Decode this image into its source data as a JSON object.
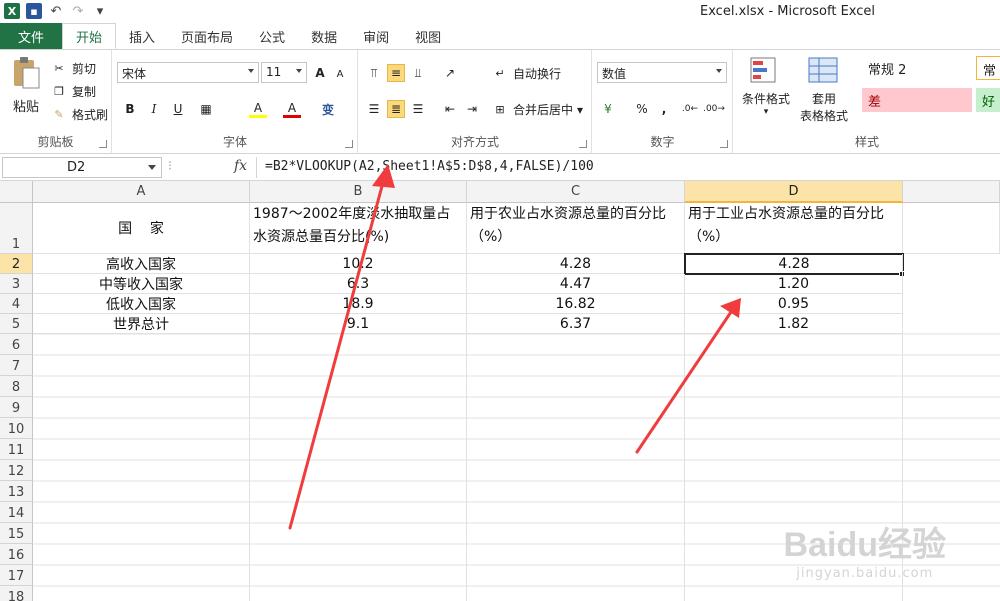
{
  "window": {
    "title": "Excel.xlsx - Microsoft Excel"
  },
  "qat": {
    "excel_icon": "X"
  },
  "tabs": [
    "文件",
    "开始",
    "插入",
    "页面布局",
    "公式",
    "数据",
    "审阅",
    "视图"
  ],
  "ribbon": {
    "clipboard": {
      "label": "剪贴板",
      "paste": "粘贴",
      "cut": "剪切",
      "copy": "复制",
      "format_painter": "格式刷"
    },
    "font": {
      "label": "字体",
      "font_name": "宋体",
      "font_size": "11",
      "grow": "A",
      "shrink": "A",
      "bold": "B",
      "italic": "I",
      "underline": "U",
      "highlight": "A",
      "font_color": "A",
      "wen": "变"
    },
    "alignment": {
      "label": "对齐方式",
      "wrap_text": "自动换行",
      "merge_center": "合并后居中"
    },
    "number": {
      "label": "数字",
      "format": "数值",
      "percent": "%",
      "comma": ","
    },
    "styles": {
      "label": "样式",
      "conditional": "条件格式",
      "table_format_1": "套用",
      "table_format_2": "表格格式",
      "cell_style_1": "常规 2",
      "cell_style_2": "差",
      "cell_style_3": "常",
      "cell_style_4": "好"
    }
  },
  "formula_bar": {
    "name_box": "D2",
    "fx": "fx",
    "formula": "=B2*VLOOKUP(A2,Sheet1!A$5:D$8,4,FALSE)/100"
  },
  "sheet": {
    "columns": [
      "A",
      "B",
      "C",
      "D"
    ],
    "rows": [
      "1",
      "2",
      "3",
      "4",
      "5",
      "6",
      "7",
      "8",
      "9",
      "10",
      "11",
      "12",
      "13",
      "14",
      "15",
      "16",
      "17",
      "18"
    ],
    "header_row": [
      "国    家",
      "1987～2002年度淡水抽取量占水资源总量百分比(%)",
      "用于农业占水资源总量的百分比（%）",
      "用于工业占水资源总量的百分比（%）"
    ],
    "data_rows": [
      [
        "高收入国家",
        "10.2",
        "4.28",
        "4.28"
      ],
      [
        "中等收入国家",
        "6.3",
        "4.47",
        "1.20"
      ],
      [
        "低收入国家",
        "18.9",
        "16.82",
        "0.95"
      ],
      [
        "世界总计",
        "9.1",
        "6.37",
        "1.82"
      ]
    ],
    "selected_cell": "D2"
  },
  "watermark": {
    "logo": "Baidu经验",
    "sub": "jingyan.baidu.com"
  },
  "colors": {
    "excel_green": "#217346",
    "arrow_red": "#f03c3c",
    "selection_header": "#fce4a8"
  }
}
